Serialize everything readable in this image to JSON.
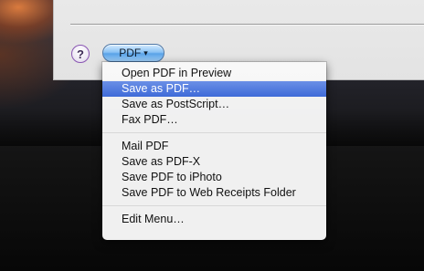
{
  "help_button": {
    "label": "?"
  },
  "pdf_button": {
    "label": "PDF",
    "caret": "▾"
  },
  "menu": {
    "groups": [
      [
        {
          "label": "Open PDF in Preview",
          "highlighted": false
        },
        {
          "label": "Save as PDF…",
          "highlighted": true
        },
        {
          "label": "Save as PostScript…",
          "highlighted": false
        },
        {
          "label": "Fax PDF…",
          "highlighted": false
        }
      ],
      [
        {
          "label": "Mail PDF",
          "highlighted": false
        },
        {
          "label": "Save as PDF-X",
          "highlighted": false
        },
        {
          "label": "Save PDF to iPhoto",
          "highlighted": false
        },
        {
          "label": "Save PDF to Web Receipts Folder",
          "highlighted": false
        }
      ],
      [
        {
          "label": "Edit Menu…",
          "highlighted": false
        }
      ]
    ]
  },
  "colors": {
    "highlight": "#3e6bd8",
    "help_border": "#8a56b3",
    "pdf_button": "#5aa3e8"
  }
}
